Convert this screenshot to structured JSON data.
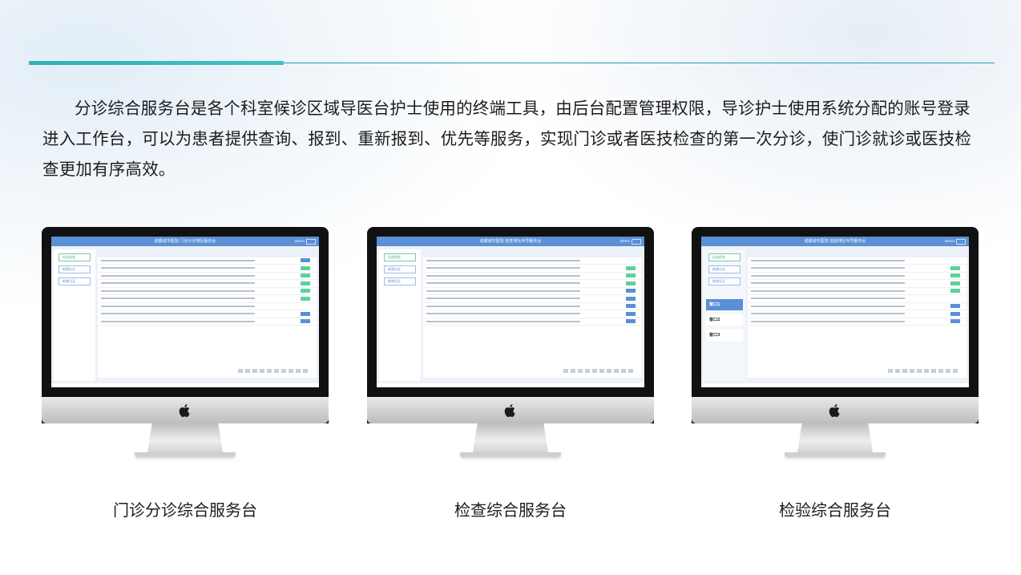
{
  "intro": "分诊综合服务台是各个科室候诊区域导医台护士使用的终端工具，由后台配置管理权限，导诊护士使用系统分配的账号登录进入工作台，可以为患者提供查询、报到、重新报到、优先等服务，实现门诊或者医技检查的第一次分诊，使门诊就诊或医技检查更加有序高效。",
  "monitors": [
    {
      "caption": "门诊分诊综合服务台",
      "screen_title": "成都城市医院 门诊分诊排队服务台",
      "side_buttons": [
        "分诊优先",
        "新建分诊",
        "新增当天"
      ],
      "user": "admin"
    },
    {
      "caption": "检查综合服务台",
      "screen_title": "成都城市医院 检查排队叫号服务台",
      "side_buttons": [
        "分诊优先",
        "新建分诊",
        "新增当天"
      ],
      "user": "admin"
    },
    {
      "caption": "检验综合服务台",
      "screen_title": "成都城市医院 检验排队叫号服务台",
      "side_buttons": [
        "分诊优先",
        "新建分诊",
        "新增当天"
      ],
      "windows": [
        "窗口1",
        "窗口2",
        "窗口3"
      ],
      "user": "admin"
    }
  ],
  "colors": {
    "accent": "#2db3b9",
    "screen_header": "#5b8fd6"
  }
}
